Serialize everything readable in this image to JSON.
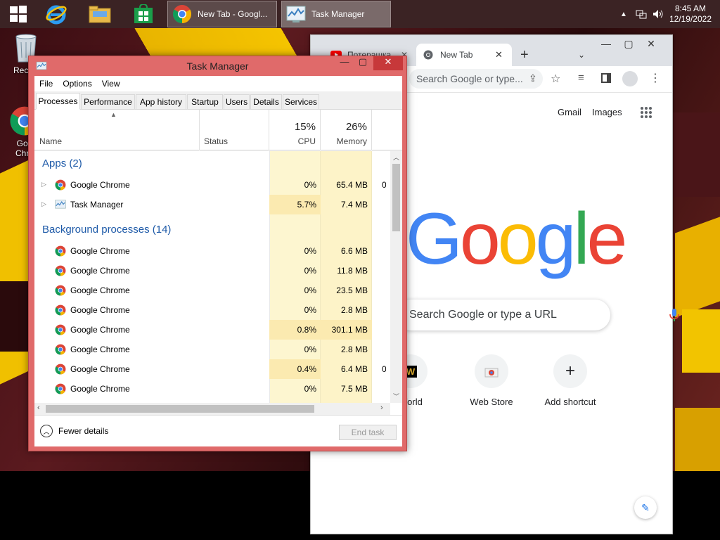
{
  "taskbar": {
    "tasks": [
      {
        "label": "New Tab - Googl...",
        "icon": "chrome-icon"
      },
      {
        "label": "Task Manager",
        "icon": "task-manager-icon"
      }
    ],
    "clock": {
      "time": "8:45 AM",
      "date": "12/19/2022"
    }
  },
  "desktop": {
    "icons": [
      {
        "label": "Recycl"
      },
      {
        "label": "Goo Chro"
      }
    ]
  },
  "chrome": {
    "tabs": [
      {
        "label": "Потерашка"
      },
      {
        "label": "New Tab"
      }
    ],
    "omnibox_placeholder": "Search Google or type...",
    "links": {
      "gmail": "Gmail",
      "images": "Images"
    },
    "logo": [
      "G",
      "o",
      "o",
      "g",
      "l",
      "e"
    ],
    "search_placeholder": "Search Google or type a URL",
    "shortcuts": [
      {
        "label": "World"
      },
      {
        "label": "Web Store"
      },
      {
        "label": "Add shortcut"
      }
    ]
  },
  "task_manager": {
    "title": "Task Manager",
    "menu": [
      "File",
      "Options",
      "View"
    ],
    "tabs": [
      "Processes",
      "Performance",
      "App history",
      "Startup",
      "Users",
      "Details",
      "Services"
    ],
    "selected_tab": "Processes",
    "columns": {
      "name": "Name",
      "status": "Status",
      "cpu_pct": "15%",
      "cpu": "CPU",
      "mem_pct": "26%",
      "memory": "Memory"
    },
    "groups": {
      "apps": "Apps (2)",
      "background": "Background processes (14)"
    },
    "apps": [
      {
        "name": "Google Chrome",
        "cpu": "0%",
        "memory": "65.4 MB",
        "extra": "0"
      },
      {
        "name": "Task Manager",
        "cpu": "5.7%",
        "memory": "7.4 MB",
        "extra": ""
      }
    ],
    "background": [
      {
        "name": "Google Chrome",
        "cpu": "0%",
        "memory": "6.6 MB",
        "extra": ""
      },
      {
        "name": "Google Chrome",
        "cpu": "0%",
        "memory": "11.8 MB",
        "extra": ""
      },
      {
        "name": "Google Chrome",
        "cpu": "0%",
        "memory": "23.5 MB",
        "extra": ""
      },
      {
        "name": "Google Chrome",
        "cpu": "0%",
        "memory": "2.8 MB",
        "extra": ""
      },
      {
        "name": "Google Chrome",
        "cpu": "0.8%",
        "memory": "301.1 MB",
        "extra": ""
      },
      {
        "name": "Google Chrome",
        "cpu": "0%",
        "memory": "2.8 MB",
        "extra": ""
      },
      {
        "name": "Google Chrome",
        "cpu": "0.4%",
        "memory": "6.4 MB",
        "extra": "0"
      },
      {
        "name": "Google Chrome",
        "cpu": "0%",
        "memory": "7.5 MB",
        "extra": ""
      }
    ],
    "fewer_details": "Fewer details",
    "end_task": "End task"
  }
}
